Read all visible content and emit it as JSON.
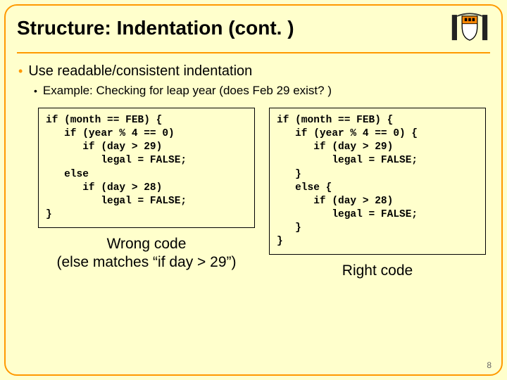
{
  "title": "Structure: Indentation (cont. )",
  "bullets": {
    "b1": "Use readable/consistent indentation",
    "b2": "Example: Checking for leap year (does Feb 29 exist? )"
  },
  "codeLeft": "if (month == FEB) {\n   if (year % 4 == 0)\n      if (day > 29)\n         legal = FALSE;\n   else\n      if (day > 28)\n         legal = FALSE;\n}",
  "codeRight": "if (month == FEB) {\n   if (year % 4 == 0) {\n      if (day > 29)\n         legal = FALSE;\n   }\n   else {\n      if (day > 28)\n         legal = FALSE;\n   }\n}",
  "captionLeft1": "Wrong code",
  "captionLeft2": "(else matches “if day > 29”)",
  "captionRight": "Right code",
  "pageNumber": "8",
  "icons": {
    "crest": "university-shield-icon"
  }
}
